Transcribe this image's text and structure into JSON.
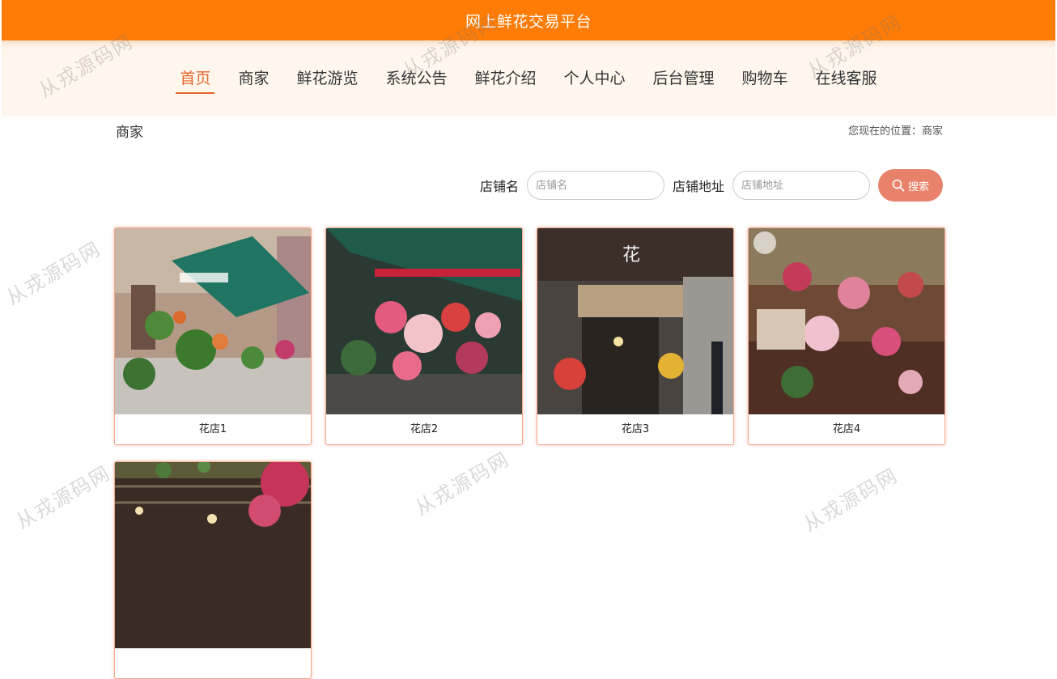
{
  "header": {
    "title": "网上鲜花交易平台"
  },
  "nav": {
    "items": [
      {
        "label": "首页",
        "active": true
      },
      {
        "label": "商家"
      },
      {
        "label": "鲜花游览"
      },
      {
        "label": "系统公告"
      },
      {
        "label": "鲜花介绍"
      },
      {
        "label": "个人中心"
      },
      {
        "label": "后台管理"
      },
      {
        "label": "购物车"
      },
      {
        "label": "在线客服"
      }
    ]
  },
  "page": {
    "section_title": "商家",
    "breadcrumb": "您现在的位置：商家"
  },
  "search": {
    "name_label": "店铺名",
    "name_placeholder": "店铺名",
    "addr_label": "店铺地址",
    "addr_placeholder": "店铺地址",
    "button_label": "搜索",
    "button_icon": "search-icon"
  },
  "shops": [
    {
      "name": "花店1"
    },
    {
      "name": "花店2"
    },
    {
      "name": "花店3"
    },
    {
      "name": "花店4"
    },
    {
      "name": ""
    }
  ],
  "watermark": "从戎源码网",
  "colors": {
    "header": "#ff7c06",
    "accent": "#e2652a",
    "search_button": "#e8826a",
    "nav_bg": "#fff7ee"
  }
}
